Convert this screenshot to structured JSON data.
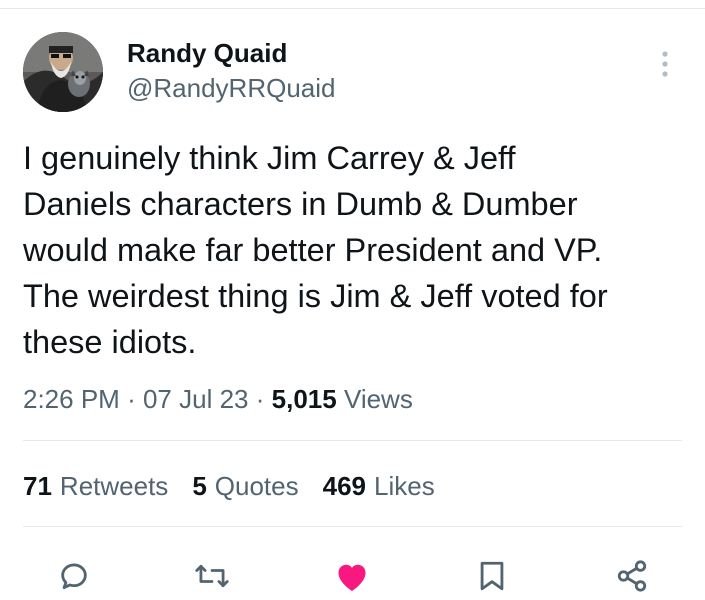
{
  "tweet": {
    "author": {
      "name": "Randy Quaid",
      "handle": "@RandyRRQuaid"
    },
    "text": "I genuinely think Jim Carrey & Jeff\nDaniels characters in Dumb & Dumber\nwould make far better President and VP.\nThe weirdest thing is Jim & Jeff voted for\nthese idiots.",
    "time": "2:26 PM",
    "date": "07 Jul 23",
    "separator": "·",
    "views_count": "5,015",
    "views_label": "Views",
    "stats": {
      "retweets_count": "71",
      "retweets_label": "Retweets",
      "quotes_count": "5",
      "quotes_label": "Quotes",
      "likes_count": "469",
      "likes_label": "Likes"
    },
    "actions": {
      "reply_icon": "speech-bubble-icon",
      "retweet_icon": "retweet-arrows-icon",
      "like_icon": "heart-icon",
      "bookmark_icon": "bookmark-icon",
      "share_icon": "share-nodes-icon"
    }
  },
  "colors": {
    "text_primary": "#0f1419",
    "text_secondary": "#536471",
    "divider": "#e6e9ec",
    "like_active": "#f91880",
    "icon_secondary": "#536471"
  }
}
